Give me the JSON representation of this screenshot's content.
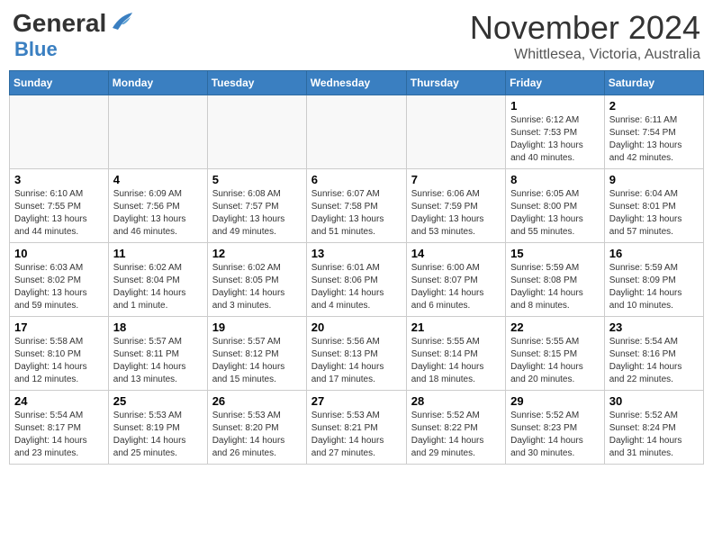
{
  "header": {
    "logo_line1a": "General",
    "logo_line1b": "",
    "logo_line2": "Blue",
    "month_title": "November 2024",
    "location": "Whittlesea, Victoria, Australia"
  },
  "weekdays": [
    "Sunday",
    "Monday",
    "Tuesday",
    "Wednesday",
    "Thursday",
    "Friday",
    "Saturday"
  ],
  "rows": [
    [
      {
        "day": "",
        "info": ""
      },
      {
        "day": "",
        "info": ""
      },
      {
        "day": "",
        "info": ""
      },
      {
        "day": "",
        "info": ""
      },
      {
        "day": "",
        "info": ""
      },
      {
        "day": "1",
        "info": "Sunrise: 6:12 AM\nSunset: 7:53 PM\nDaylight: 13 hours and 40 minutes."
      },
      {
        "day": "2",
        "info": "Sunrise: 6:11 AM\nSunset: 7:54 PM\nDaylight: 13 hours and 42 minutes."
      }
    ],
    [
      {
        "day": "3",
        "info": "Sunrise: 6:10 AM\nSunset: 7:55 PM\nDaylight: 13 hours and 44 minutes."
      },
      {
        "day": "4",
        "info": "Sunrise: 6:09 AM\nSunset: 7:56 PM\nDaylight: 13 hours and 46 minutes."
      },
      {
        "day": "5",
        "info": "Sunrise: 6:08 AM\nSunset: 7:57 PM\nDaylight: 13 hours and 49 minutes."
      },
      {
        "day": "6",
        "info": "Sunrise: 6:07 AM\nSunset: 7:58 PM\nDaylight: 13 hours and 51 minutes."
      },
      {
        "day": "7",
        "info": "Sunrise: 6:06 AM\nSunset: 7:59 PM\nDaylight: 13 hours and 53 minutes."
      },
      {
        "day": "8",
        "info": "Sunrise: 6:05 AM\nSunset: 8:00 PM\nDaylight: 13 hours and 55 minutes."
      },
      {
        "day": "9",
        "info": "Sunrise: 6:04 AM\nSunset: 8:01 PM\nDaylight: 13 hours and 57 minutes."
      }
    ],
    [
      {
        "day": "10",
        "info": "Sunrise: 6:03 AM\nSunset: 8:02 PM\nDaylight: 13 hours and 59 minutes."
      },
      {
        "day": "11",
        "info": "Sunrise: 6:02 AM\nSunset: 8:04 PM\nDaylight: 14 hours and 1 minute."
      },
      {
        "day": "12",
        "info": "Sunrise: 6:02 AM\nSunset: 8:05 PM\nDaylight: 14 hours and 3 minutes."
      },
      {
        "day": "13",
        "info": "Sunrise: 6:01 AM\nSunset: 8:06 PM\nDaylight: 14 hours and 4 minutes."
      },
      {
        "day": "14",
        "info": "Sunrise: 6:00 AM\nSunset: 8:07 PM\nDaylight: 14 hours and 6 minutes."
      },
      {
        "day": "15",
        "info": "Sunrise: 5:59 AM\nSunset: 8:08 PM\nDaylight: 14 hours and 8 minutes."
      },
      {
        "day": "16",
        "info": "Sunrise: 5:59 AM\nSunset: 8:09 PM\nDaylight: 14 hours and 10 minutes."
      }
    ],
    [
      {
        "day": "17",
        "info": "Sunrise: 5:58 AM\nSunset: 8:10 PM\nDaylight: 14 hours and 12 minutes."
      },
      {
        "day": "18",
        "info": "Sunrise: 5:57 AM\nSunset: 8:11 PM\nDaylight: 14 hours and 13 minutes."
      },
      {
        "day": "19",
        "info": "Sunrise: 5:57 AM\nSunset: 8:12 PM\nDaylight: 14 hours and 15 minutes."
      },
      {
        "day": "20",
        "info": "Sunrise: 5:56 AM\nSunset: 8:13 PM\nDaylight: 14 hours and 17 minutes."
      },
      {
        "day": "21",
        "info": "Sunrise: 5:55 AM\nSunset: 8:14 PM\nDaylight: 14 hours and 18 minutes."
      },
      {
        "day": "22",
        "info": "Sunrise: 5:55 AM\nSunset: 8:15 PM\nDaylight: 14 hours and 20 minutes."
      },
      {
        "day": "23",
        "info": "Sunrise: 5:54 AM\nSunset: 8:16 PM\nDaylight: 14 hours and 22 minutes."
      }
    ],
    [
      {
        "day": "24",
        "info": "Sunrise: 5:54 AM\nSunset: 8:17 PM\nDaylight: 14 hours and 23 minutes."
      },
      {
        "day": "25",
        "info": "Sunrise: 5:53 AM\nSunset: 8:19 PM\nDaylight: 14 hours and 25 minutes."
      },
      {
        "day": "26",
        "info": "Sunrise: 5:53 AM\nSunset: 8:20 PM\nDaylight: 14 hours and 26 minutes."
      },
      {
        "day": "27",
        "info": "Sunrise: 5:53 AM\nSunset: 8:21 PM\nDaylight: 14 hours and 27 minutes."
      },
      {
        "day": "28",
        "info": "Sunrise: 5:52 AM\nSunset: 8:22 PM\nDaylight: 14 hours and 29 minutes."
      },
      {
        "day": "29",
        "info": "Sunrise: 5:52 AM\nSunset: 8:23 PM\nDaylight: 14 hours and 30 minutes."
      },
      {
        "day": "30",
        "info": "Sunrise: 5:52 AM\nSunset: 8:24 PM\nDaylight: 14 hours and 31 minutes."
      }
    ]
  ]
}
